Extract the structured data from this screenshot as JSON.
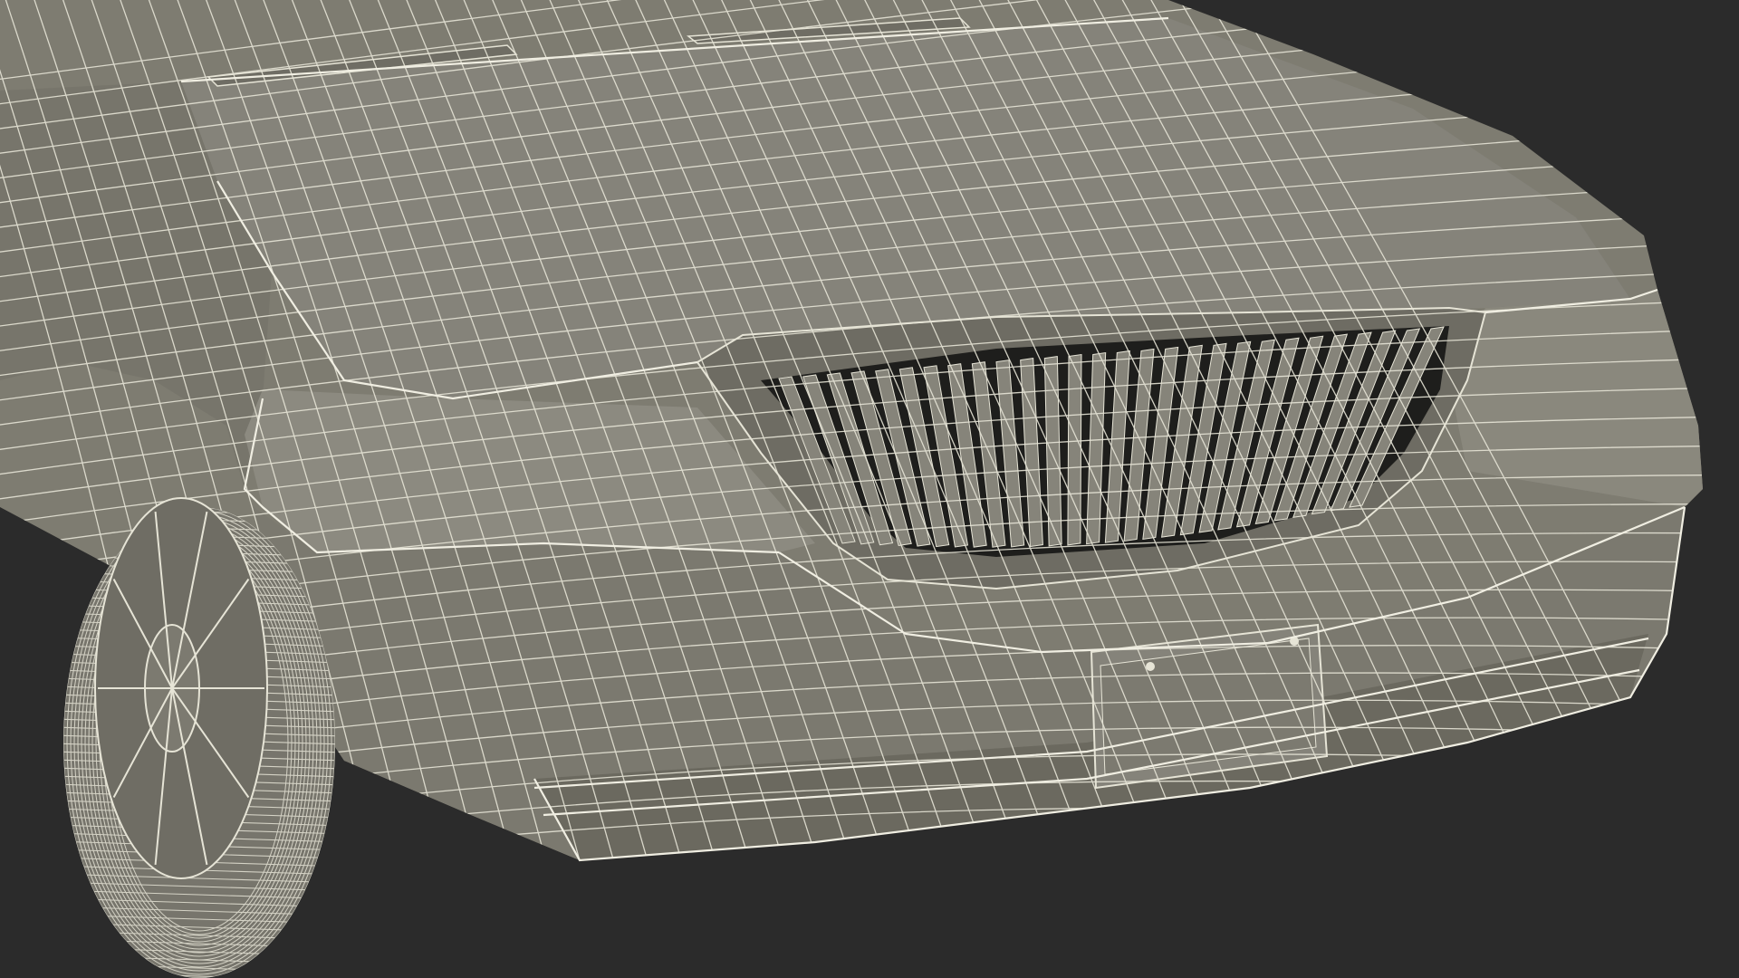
{
  "scene": {
    "subject": "car-front-wireframe-render",
    "colors": {
      "background": "#2b2b2b",
      "surface": "#7e7c71",
      "surface_light": "#8c8a7f",
      "surface_dark": "#5f5d55",
      "wire": "#e6e4d6",
      "grille_slot": "#1e1e1c"
    }
  }
}
